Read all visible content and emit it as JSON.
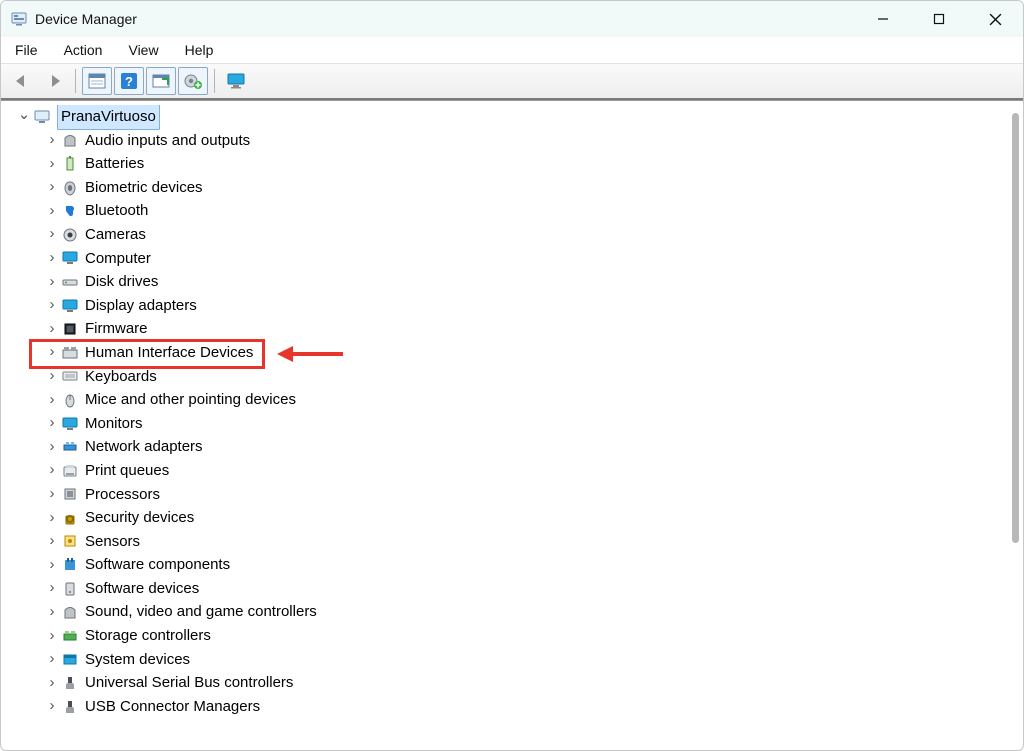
{
  "title": "Device Manager",
  "menus": [
    "File",
    "Action",
    "View",
    "Help"
  ],
  "toolbar": {
    "back": "Back",
    "forward": "Forward",
    "properties": "Properties",
    "help": "Help",
    "scan": "Scan for hardware changes",
    "addDriver": "Add drivers",
    "showHidden": "Show hidden devices"
  },
  "tree": {
    "root": "PranaVirtuoso",
    "items": [
      "Audio inputs and outputs",
      "Batteries",
      "Biometric devices",
      "Bluetooth",
      "Cameras",
      "Computer",
      "Disk drives",
      "Display adapters",
      "Firmware",
      "Human Interface Devices",
      "Keyboards",
      "Mice and other pointing devices",
      "Monitors",
      "Network adapters",
      "Print queues",
      "Processors",
      "Security devices",
      "Sensors",
      "Software components",
      "Software devices",
      "Sound, video and game controllers",
      "Storage controllers",
      "System devices",
      "Universal Serial Bus controllers",
      "USB Connector Managers"
    ]
  },
  "highlight": {
    "index": 9
  },
  "icons": [
    "audio-icon",
    "battery-icon",
    "biometric-icon",
    "bluetooth-icon",
    "camera-icon",
    "computer-icon",
    "disk-icon",
    "display-icon",
    "firmware-icon",
    "hid-icon",
    "keyboard-icon",
    "mouse-icon",
    "monitor-icon",
    "network-icon",
    "printer-icon",
    "processor-icon",
    "security-icon",
    "sensor-icon",
    "softcomp-icon",
    "softdev-icon",
    "sound-icon",
    "storage-icon",
    "system-icon",
    "usb-icon",
    "usbconn-icon"
  ]
}
